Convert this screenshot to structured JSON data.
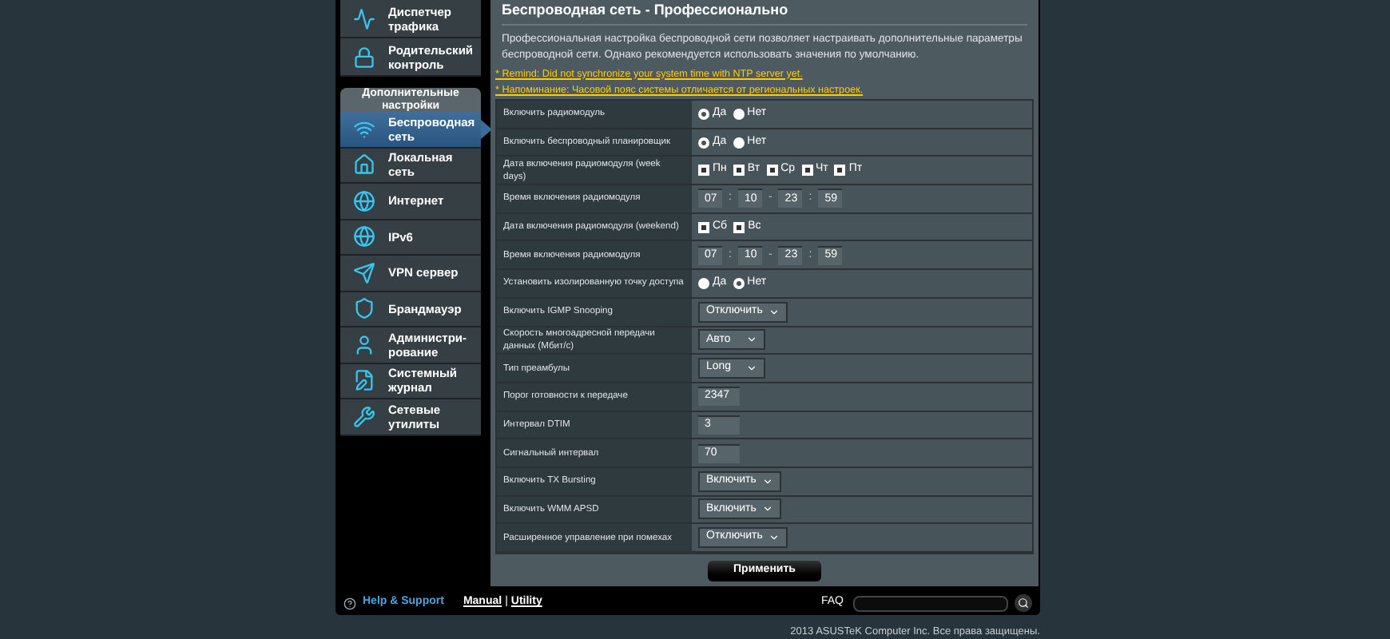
{
  "sidebar": {
    "top_items": [
      {
        "label": "Диспетчер трафика",
        "selected": false
      },
      {
        "label": "Родительский контроль",
        "selected": false
      }
    ],
    "section_title": "Дополнительные настройки",
    "items": [
      {
        "label": "Беспроводная сеть",
        "selected": true
      },
      {
        "label": "Локальная сеть",
        "selected": false
      },
      {
        "label": "Интернет",
        "selected": false
      },
      {
        "label": "IPv6",
        "selected": false
      },
      {
        "label": "VPN сервер",
        "selected": false
      },
      {
        "label": "Брандмауэр",
        "selected": false
      },
      {
        "label": "Администри-рование",
        "selected": false
      },
      {
        "label": "Системный журнал",
        "selected": false
      },
      {
        "label": "Сетевые утилиты",
        "selected": false
      }
    ]
  },
  "page": {
    "title": "Беспроводная сеть - Профессионально",
    "description": "Профессиональная настройка беспроводной сети позволяет настраивать дополнительные параметры беспроводной сети. Однако рекомендуется использовать значения по умолчанию.",
    "warnings": [
      "* Remind: Did not synchronize your system time with NTP server yet.",
      "* Напоминание: Часовой пояс системы отличается от региональных настроек."
    ],
    "rows": [
      {
        "kind": "radio",
        "label": "Включить радиомодуль",
        "options": [
          {
            "label": "Да",
            "selected": true
          },
          {
            "label": "Нет",
            "selected": false
          }
        ]
      },
      {
        "kind": "radio",
        "label": "Включить беспроводный планировщик",
        "options": [
          {
            "label": "Да",
            "selected": true
          },
          {
            "label": "Нет",
            "selected": false
          }
        ]
      },
      {
        "kind": "checks",
        "label": "Дата включения радиомодуля (week days)",
        "options": [
          {
            "label": "Пн",
            "checked": true
          },
          {
            "label": "Вт",
            "checked": true
          },
          {
            "label": "Ср",
            "checked": true
          },
          {
            "label": "Чт",
            "checked": true
          },
          {
            "label": "Пт",
            "checked": true
          }
        ]
      },
      {
        "kind": "time",
        "label": "Время включения радиомодуля",
        "parts": [
          "07",
          "10",
          "23",
          "59"
        ],
        "separators": [
          ":",
          "-",
          ":"
        ]
      },
      {
        "kind": "checks",
        "label": "Дата включения радиомодуля (weekend)",
        "options": [
          {
            "label": "Сб",
            "checked": true
          },
          {
            "label": "Вс",
            "checked": true
          }
        ]
      },
      {
        "kind": "time",
        "label": "Время включения радиомодуля",
        "parts": [
          "07",
          "10",
          "23",
          "59"
        ],
        "separators": [
          ":",
          "-",
          ":"
        ]
      },
      {
        "kind": "radio",
        "label": "Установить изолированную точку доступа",
        "options": [
          {
            "label": "Да",
            "selected": false
          },
          {
            "label": "Нет",
            "selected": true
          }
        ]
      },
      {
        "kind": "select",
        "label": "Включить IGMP Snooping",
        "value": "Отключить"
      },
      {
        "kind": "select",
        "label": "Скорость многоадресной передачи данных (Мбит/с)",
        "value": "Авто"
      },
      {
        "kind": "select",
        "label": "Тип преамбулы",
        "value": "Long"
      },
      {
        "kind": "text",
        "label": "Порог готовности к передаче",
        "value": "2347"
      },
      {
        "kind": "text",
        "label": "Интервал DTIM",
        "value": "3"
      },
      {
        "kind": "text",
        "label": "Сигнальный интервал",
        "value": "70"
      },
      {
        "kind": "select",
        "label": "Включить TX Bursting",
        "value": "Включить"
      },
      {
        "kind": "select",
        "label": "Включить WMM APSD",
        "value": "Включить"
      },
      {
        "kind": "select",
        "label": "Расширенное управление при помехах",
        "value": "Отключить"
      }
    ],
    "apply_button": "Применить"
  },
  "footer": {
    "help": "Help & Support",
    "links": [
      "Manual",
      "Utility"
    ],
    "link_separator": "|",
    "faq": "FAQ"
  },
  "copyright": "2013  ASUSTeK Computer Inc. Все права защищены."
}
